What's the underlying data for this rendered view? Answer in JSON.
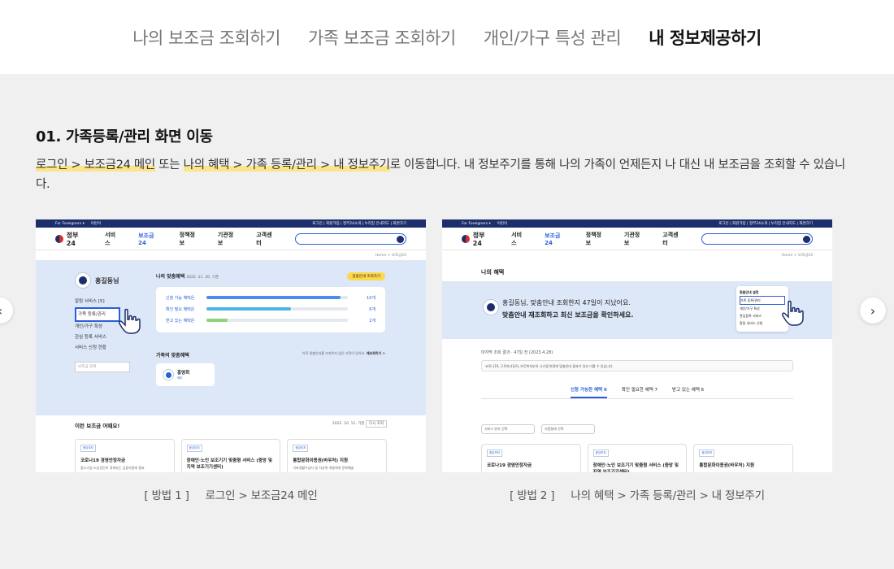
{
  "top_tabs": [
    {
      "label": "나의 보조금 조회하기",
      "active": false
    },
    {
      "label": "가족 보조금 조회하기",
      "active": false
    },
    {
      "label": "개인/가구 특성 관리",
      "active": false
    },
    {
      "label": "내 정보제공하기",
      "active": true
    }
  ],
  "section": {
    "heading": "01. 가족등록/관리 화면 이동",
    "desc_part1": "로그인 > 보조금24 메인",
    "desc_part2": " 또는 ",
    "desc_part3": "나의 혜택 > 가족 등록/관리 > 내 정보주기",
    "desc_part4": "로 이동합니다. 내 정보주기를 통해 나의 가족이 언제든지 나 대신 내 보조금을 조회할 수 있습니다."
  },
  "carousel": {
    "prev_icon": "chevron-left-icon",
    "next_icon": "chevron-right-icon",
    "prev_glyph": "‹",
    "next_glyph": "›"
  },
  "captions": [
    {
      "label": "[ 방법 1 ]",
      "text": "로그인 > 보조금24 메인"
    },
    {
      "label": "[ 방법 2 ]",
      "text": "나의 혜택 > 가족 등록/관리 > 내 정보주기"
    }
  ],
  "mini": {
    "util_left": "For Foreigners ▾",
    "util_left2": "어린이",
    "util_right": "로그인 | 회원가입 | 정부24소개 | 누리집 안내지도 | 화면크기",
    "logo": "정부24",
    "menu": [
      "서비스",
      "보조금24",
      "정책정보",
      "기관정보",
      "고객센터"
    ],
    "crumb": "Home > 보조금24",
    "user": "홍길동님",
    "side_menu": [
      "알림 서비스 [5]",
      "가족 등록/관리",
      "개인/가구 특성",
      "관심 등록 서비스",
      "서비스 신청 현황"
    ],
    "side_search": "보조금 검색",
    "my_title": "나의 맞춤혜택",
    "my_date": "2022. 11. 20. 기준",
    "my_btn": "맞춤안내 조회하기",
    "bars": [
      {
        "label": "신청 가능 혜택은",
        "count": "10개",
        "fraction": 0.95,
        "color": "#4a8df0"
      },
      {
        "label": "확인 필요 혜택은",
        "count": "6개",
        "fraction": 0.6,
        "color": "#49b5e6"
      },
      {
        "label": "받고 있는 혜택은",
        "count": "2개",
        "fraction": 0.15,
        "color": "#8fd17a"
      }
    ],
    "fam_title": "가족의 맞춤혜택",
    "fam_note": "아직 맞춤안내를 조회하지 않은 가족이 있어요.",
    "fam_link": "재조회하기 >",
    "fam_member": "홍영희",
    "fam_tag": "배우",
    "lower_title": "이런 보조금 어때요!",
    "lower_date": "2022. 10. 11. 기준",
    "lower_btn": "다시 조회",
    "cards": [
      {
        "tag": "중앙부처",
        "title": "코로나19 경영안정자금",
        "sub": "중소기업·소상공인이 겪게되는 금융지원에 필요"
      },
      {
        "tag": "중앙부처",
        "title": "장애인·노인 보조기기 맞춤형 서비스 (중앙 및 지역 보조기기센터)",
        "sub": ""
      },
      {
        "tag": "중앙부처",
        "title": "통합문화이용권(바우처) 지원",
        "sub": "기초생활수급자 및 차상위 계층에게 문화예술"
      }
    ],
    "page2_title": "나의 혜택",
    "hero_msg1": "홍길동님, 맞춤안내 조회한지 47일이 지났어요.",
    "hero_msg2": "맞춤안내 재조회하고 최신 보조금을 확인하세요.",
    "pop_title": "맞춤안내 설정",
    "pop_items": [
      "가족 등록/관리",
      "개인/가구 특성",
      "관심등록 서비스",
      "알림 서비스 신청"
    ],
    "last_check": "마지막 조회 결과 · 47일 전 (2023.4.28)",
    "notice": "코로나19, 근로자녀장려, 보건복지부의 시스템 변경에 맞춤안내 결과가 일부 다를 수 있습니다.",
    "tabs": [
      {
        "label": "신청 가능한 혜택",
        "count": "6"
      },
      {
        "label": "확인 필요한 혜택",
        "count": "7"
      },
      {
        "label": "받고 있는 혜택",
        "count": "6"
      }
    ],
    "filter1": "서비스 분야 선택",
    "filter2": "지원형태 선택"
  }
}
